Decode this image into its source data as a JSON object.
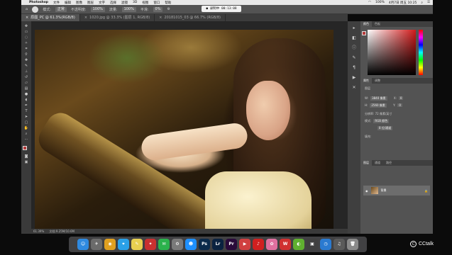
{
  "menubar": {
    "app": "Photoshop",
    "items": [
      "文件",
      "编辑",
      "图像",
      "图层",
      "文字",
      "选择",
      "滤镜",
      "3D",
      "视图",
      "窗口",
      "帮助"
    ],
    "battery": "100%",
    "clock": "4月7日 周五 10:25"
  },
  "options": {
    "mode_label": "模式:",
    "mode_value": "正常",
    "opacity_label": "不透明度:",
    "opacity_value": "100%",
    "flow_label": "流量:",
    "flow_value": "100%",
    "smooth_label": "平滑:",
    "smooth_value": "0%"
  },
  "recorder": {
    "time": "● 录制中 00:13:08"
  },
  "tabs": [
    {
      "label": "原图_PC @ 61.3%(RGB/8)",
      "active": true
    },
    {
      "label": "1020.jpg @ 33.3% (图层 1, RGB/8)",
      "active": false
    },
    {
      "label": "20181015_03 @ 66.7% (RGB/8)",
      "active": false
    }
  ],
  "status": {
    "zoom": "61.39%",
    "doc": "文档:9.25M/10.6M"
  },
  "panels": {
    "color_tabs": [
      "颜色",
      "色板"
    ],
    "props_tabs": [
      "属性",
      "调整"
    ],
    "props_title": "图层",
    "width_label": "W:",
    "width_value": "3840 像素",
    "height_label": "H:",
    "height_value": "2560 像素",
    "x_label": "X:",
    "x_value": "0",
    "y_label": "Y:",
    "y_value": "0",
    "resolution": "分辨率: 72 像素/英寸",
    "mode_label": "模式:",
    "mode_value": "RGB 颜色",
    "depth_value": "8 位/通道",
    "fill_label": "填充:",
    "layers_tabs": [
      "图层",
      "通道",
      "路径"
    ],
    "layer_name": "背景"
  },
  "dock": {
    "apps": [
      {
        "icon": "finder-icon",
        "glyph": "☺",
        "color": "#2f8ae0"
      },
      {
        "icon": "launchpad-icon",
        "glyph": "✈",
        "color": "#6b6b6b"
      },
      {
        "icon": "chrome-icon",
        "glyph": "◉",
        "color": "#e0a020"
      },
      {
        "icon": "safari-icon",
        "glyph": "⌖",
        "color": "#2aa0e8"
      },
      {
        "icon": "notes-icon",
        "glyph": "✎",
        "color": "#e8d050"
      },
      {
        "icon": "stamp-icon",
        "glyph": "✦",
        "color": "#c83030"
      },
      {
        "icon": "wechat-icon",
        "glyph": "✉",
        "color": "#2bb24c"
      },
      {
        "icon": "settings-icon",
        "glyph": "⚙",
        "color": "#7a7a7a"
      },
      {
        "icon": "qq-icon",
        "glyph": "☻",
        "color": "#1e90ff"
      },
      {
        "icon": "photoshop-icon",
        "glyph": "Ps",
        "color": "#0a2a4a"
      },
      {
        "icon": "lightroom-icon",
        "glyph": "Lr",
        "color": "#0a2240"
      },
      {
        "icon": "premiere-icon",
        "glyph": "Pr",
        "color": "#2a0a3a"
      },
      {
        "icon": "movie-icon",
        "glyph": "▶",
        "color": "#d04040"
      },
      {
        "icon": "netease-icon",
        "glyph": "♪",
        "color": "#d02020"
      },
      {
        "icon": "photos-icon",
        "glyph": "✿",
        "color": "#e070a0"
      },
      {
        "icon": "wps-icon",
        "glyph": "W",
        "color": "#d03030"
      },
      {
        "icon": "game-icon",
        "glyph": "◐",
        "color": "#60b030"
      },
      {
        "icon": "monitor-icon",
        "glyph": "▣",
        "color": "#404040"
      },
      {
        "icon": "clock-icon",
        "glyph": "◷",
        "color": "#2a7ad0"
      },
      {
        "icon": "music-icon",
        "glyph": "♫",
        "color": "#5a5a5a"
      },
      {
        "icon": "trash-icon",
        "glyph": "🗑",
        "color": "#8a8a8a"
      }
    ]
  },
  "watermark": {
    "c": "C",
    "text": "CCtalk"
  },
  "colors": {
    "foreground": "#b53b3b",
    "background": "#ffffff",
    "accent": "#d21a1a"
  }
}
